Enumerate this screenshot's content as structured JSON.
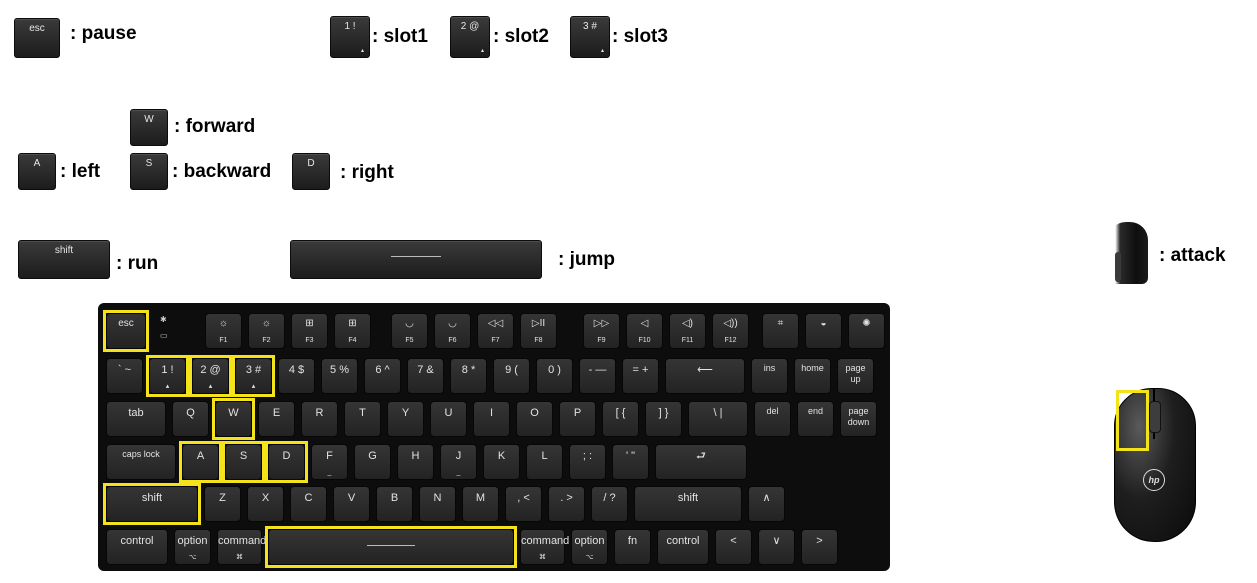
{
  "legend": [
    {
      "id": "pause",
      "key": "esc",
      "sub": "",
      "label": ": pause"
    },
    {
      "id": "slot1",
      "key": "1 !",
      "sub": "▴",
      "label": ": slot1"
    },
    {
      "id": "slot2",
      "key": "2 @",
      "sub": "▴",
      "label": ": slot2"
    },
    {
      "id": "slot3",
      "key": "3 #",
      "sub": "▴",
      "label": ": slot3"
    },
    {
      "id": "forward",
      "key": "W",
      "sub": "",
      "label": ": forward"
    },
    {
      "id": "left",
      "key": "A",
      "sub": "",
      "label": ": left"
    },
    {
      "id": "backward",
      "key": "S",
      "sub": "",
      "label": ": backward"
    },
    {
      "id": "right",
      "key": "D",
      "sub": "",
      "label": ": right"
    },
    {
      "id": "run",
      "key": "shift",
      "sub": "",
      "label": ": run"
    },
    {
      "id": "jump",
      "key": "",
      "sub": "",
      "label": ": jump"
    },
    {
      "id": "attack",
      "key": "",
      "sub": "",
      "label": ": attack"
    }
  ],
  "keyboard": {
    "leds": [
      "✱",
      "▭"
    ],
    "rows": [
      [
        {
          "t": "esc",
          "s": ""
        },
        {
          "t": "☼",
          "s": "F1"
        },
        {
          "t": "☼",
          "s": "F2"
        },
        {
          "t": "⊞",
          "s": "F3"
        },
        {
          "t": "⊞",
          "s": "F4"
        },
        {
          "t": "◡",
          "s": "F5"
        },
        {
          "t": "◡",
          "s": "F6"
        },
        {
          "t": "◁◁",
          "s": "F7"
        },
        {
          "t": "▷II",
          "s": "F8"
        },
        {
          "t": "▷▷",
          "s": "F9"
        },
        {
          "t": "◁",
          "s": "F10"
        },
        {
          "t": "◁)",
          "s": "F11"
        },
        {
          "t": "◁))",
          "s": "F12"
        },
        {
          "t": "⌗",
          "s": ""
        },
        {
          "t": "◒",
          "s": ""
        },
        {
          "t": "✺",
          "s": ""
        }
      ],
      [
        {
          "t": "` ~",
          "s": ""
        },
        {
          "t": "1 !",
          "s": "▴"
        },
        {
          "t": "2 @",
          "s": "▴"
        },
        {
          "t": "3 #",
          "s": "▴"
        },
        {
          "t": "4 $",
          "s": ""
        },
        {
          "t": "5 %",
          "s": ""
        },
        {
          "t": "6 ^",
          "s": ""
        },
        {
          "t": "7 &",
          "s": ""
        },
        {
          "t": "8 *",
          "s": ""
        },
        {
          "t": "9 (",
          "s": ""
        },
        {
          "t": "0 )",
          "s": ""
        },
        {
          "t": "- —",
          "s": ""
        },
        {
          "t": "= +",
          "s": ""
        },
        {
          "t": "⟵",
          "s": ""
        },
        {
          "t": "ins",
          "s": ""
        },
        {
          "t": "home",
          "s": ""
        },
        {
          "t": "page\nup",
          "s": ""
        }
      ],
      [
        {
          "t": "tab",
          "s": ""
        },
        {
          "t": "Q",
          "s": ""
        },
        {
          "t": "W",
          "s": ""
        },
        {
          "t": "E",
          "s": ""
        },
        {
          "t": "R",
          "s": ""
        },
        {
          "t": "T",
          "s": ""
        },
        {
          "t": "Y",
          "s": ""
        },
        {
          "t": "U",
          "s": ""
        },
        {
          "t": "I",
          "s": ""
        },
        {
          "t": "O",
          "s": ""
        },
        {
          "t": "P",
          "s": ""
        },
        {
          "t": "[ {",
          "s": ""
        },
        {
          "t": "] }",
          "s": ""
        },
        {
          "t": "\\ |",
          "s": ""
        },
        {
          "t": "del",
          "s": ""
        },
        {
          "t": "end",
          "s": ""
        },
        {
          "t": "page\ndown",
          "s": ""
        }
      ],
      [
        {
          "t": "caps lock",
          "s": ""
        },
        {
          "t": "A",
          "s": ""
        },
        {
          "t": "S",
          "s": ""
        },
        {
          "t": "D",
          "s": ""
        },
        {
          "t": "F",
          "s": "_"
        },
        {
          "t": "G",
          "s": ""
        },
        {
          "t": "H",
          "s": ""
        },
        {
          "t": "J",
          "s": "_"
        },
        {
          "t": "K",
          "s": ""
        },
        {
          "t": "L",
          "s": ""
        },
        {
          "t": "; :",
          "s": ""
        },
        {
          "t": "' \"",
          "s": ""
        },
        {
          "t": "⮐",
          "s": ""
        }
      ],
      [
        {
          "t": "shift",
          "s": ""
        },
        {
          "t": "Z",
          "s": ""
        },
        {
          "t": "X",
          "s": ""
        },
        {
          "t": "C",
          "s": ""
        },
        {
          "t": "V",
          "s": ""
        },
        {
          "t": "B",
          "s": ""
        },
        {
          "t": "N",
          "s": ""
        },
        {
          "t": "M",
          "s": ""
        },
        {
          "t": ", <",
          "s": ""
        },
        {
          "t": ". >",
          "s": ""
        },
        {
          "t": "/ ?",
          "s": ""
        },
        {
          "t": "shift",
          "s": ""
        },
        {
          "t": "∧",
          "s": ""
        }
      ],
      [
        {
          "t": "control",
          "s": ""
        },
        {
          "t": "option",
          "s": "⌥"
        },
        {
          "t": "command",
          "s": "⌘"
        },
        {
          "t": "",
          "s": ""
        },
        {
          "t": "command",
          "s": "⌘"
        },
        {
          "t": "option",
          "s": "⌥"
        },
        {
          "t": "fn",
          "s": ""
        },
        {
          "t": "control",
          "s": ""
        },
        {
          "t": "<",
          "s": ""
        },
        {
          "t": "∨",
          "s": ""
        },
        {
          "t": ">",
          "s": ""
        }
      ]
    ]
  },
  "mouse": {
    "logo": "hp"
  }
}
